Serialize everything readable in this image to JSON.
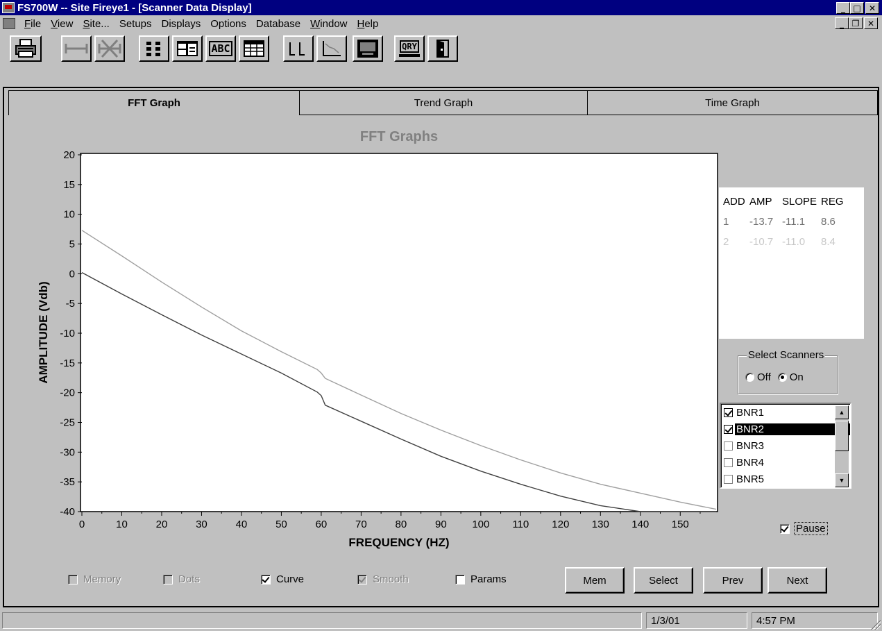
{
  "window": {
    "title": "FS700W -- Site Fireye1 - [Scanner Data Display]"
  },
  "menu": {
    "items": [
      {
        "label": "File",
        "underline": "F",
        "rest": "ile"
      },
      {
        "label": "View",
        "underline": "V",
        "rest": "iew"
      },
      {
        "label": "Site...",
        "underline": "S",
        "rest": "ite..."
      },
      {
        "label": "Setups",
        "underline": "",
        "rest": "Setups"
      },
      {
        "label": "Displays",
        "underline": "",
        "rest": "Displays"
      },
      {
        "label": "Options",
        "underline": "",
        "rest": "Options"
      },
      {
        "label": "Database",
        "underline": "",
        "rest": "Database"
      },
      {
        "label": "Window",
        "underline": "W",
        "rest": "indow"
      },
      {
        "label": "Help",
        "underline": "H",
        "rest": "elp"
      }
    ]
  },
  "toolbar": {
    "buttons": [
      "print-icon",
      "connect-icon",
      "disconnect-icon",
      "list-icon",
      "data-grid-icon",
      "abc-icon",
      "table-icon",
      "bar-graph-icon",
      "trend-graph-icon",
      "meter-icon",
      "query-icon",
      "door-exit-icon"
    ],
    "abc_label": "ABC",
    "qry_label": "QRY"
  },
  "tabs": [
    {
      "label": "FFT Graph",
      "active": true
    },
    {
      "label": "Trend Graph",
      "active": false
    },
    {
      "label": "Time Graph",
      "active": false
    }
  ],
  "chart_data": {
    "type": "line",
    "title": "FFT Graphs",
    "xlabel": "FREQUENCY (HZ)",
    "ylabel": "AMPLITUDE (Vdb)",
    "xlim": [
      0,
      159
    ],
    "ylim": [
      -40,
      20
    ],
    "xticks": [
      0,
      10,
      20,
      30,
      40,
      50,
      60,
      70,
      80,
      90,
      100,
      110,
      120,
      130,
      140,
      150
    ],
    "yticks": [
      20,
      15,
      10,
      5,
      0,
      -5,
      -10,
      -15,
      -20,
      -25,
      -30,
      -35,
      -40
    ],
    "grid": false,
    "series": [
      {
        "color": "#404040",
        "x": [
          0,
          10,
          20,
          30,
          40,
          50,
          59,
          60,
          61,
          70,
          80,
          90,
          100,
          110,
          120,
          130,
          140,
          150,
          159
        ],
        "y": [
          0.2,
          -3.4,
          -6.9,
          -10.3,
          -13.5,
          -16.7,
          -19.9,
          -20.5,
          -22.1,
          -24.8,
          -27.8,
          -30.7,
          -33.2,
          -35.4,
          -37.4,
          -39.0,
          -40.0,
          -40.0,
          -40.0
        ]
      },
      {
        "color": "#a0a0a0",
        "x": [
          0,
          10,
          20,
          30,
          40,
          50,
          59,
          60,
          61,
          70,
          80,
          90,
          100,
          110,
          120,
          130,
          140,
          150,
          159
        ],
        "y": [
          7.3,
          3.0,
          -1.4,
          -5.6,
          -9.6,
          -13.1,
          -16.1,
          -16.7,
          -17.6,
          -20.4,
          -23.5,
          -26.3,
          -28.9,
          -31.3,
          -33.5,
          -35.4,
          -36.9,
          -38.4,
          -39.6
        ]
      }
    ]
  },
  "params": {
    "headers": [
      "ADD",
      "AMP",
      "SLOPE",
      "REG"
    ],
    "rows": [
      {
        "add": "1",
        "amp": "-13.7",
        "slope": "-11.1",
        "reg": "8.6",
        "color": "#707070"
      },
      {
        "add": "2",
        "amp": "-10.7",
        "slope": "-11.0",
        "reg": "8.4",
        "color": "#c8c8c8"
      }
    ]
  },
  "scanner_select": {
    "legend": "Select Scanners",
    "off_label": "Off",
    "on_label": "On",
    "selected": "On"
  },
  "scanners": [
    {
      "label": "BNR1",
      "checked": true,
      "selected": false
    },
    {
      "label": "BNR2",
      "checked": true,
      "selected": true
    },
    {
      "label": "BNR3",
      "checked": false,
      "selected": false
    },
    {
      "label": "BNR4",
      "checked": false,
      "selected": false
    },
    {
      "label": "BNR5",
      "checked": false,
      "selected": false
    }
  ],
  "pause": {
    "label": "Pause",
    "checked": true
  },
  "options": {
    "memory": {
      "label": "Memory",
      "checked": false,
      "enabled": false
    },
    "dots": {
      "label": "Dots",
      "checked": false,
      "enabled": false
    },
    "curve": {
      "label": "Curve",
      "checked": true,
      "enabled": true
    },
    "smooth": {
      "label": "Smooth",
      "checked": true,
      "enabled": false
    },
    "params": {
      "label": "Params",
      "checked": false,
      "enabled": true
    }
  },
  "buttons": {
    "mem": "Mem",
    "select": "Select",
    "prev": "Prev",
    "next": "Next"
  },
  "status": {
    "message": "",
    "date": "1/3/01",
    "time": "4:57 PM"
  }
}
